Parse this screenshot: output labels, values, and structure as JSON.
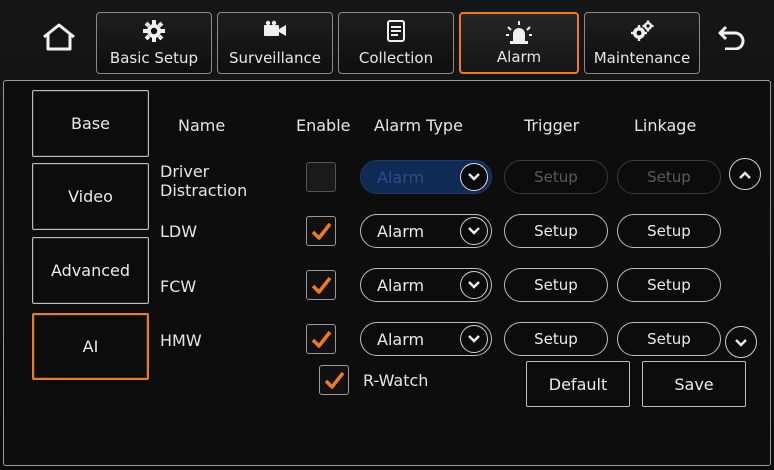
{
  "top_nav": {
    "home_icon": "home-icon",
    "back_icon": "back-arrow-icon",
    "tabs": [
      {
        "label": "Basic Setup",
        "icon": "gear-icon"
      },
      {
        "label": "Surveillance",
        "icon": "camera-icon"
      },
      {
        "label": "Collection",
        "icon": "document-icon"
      },
      {
        "label": "Alarm",
        "icon": "alarm-light-icon"
      },
      {
        "label": "Maintenance",
        "icon": "gears-icon"
      }
    ],
    "active_tab": "Alarm"
  },
  "side_menu": {
    "items": [
      {
        "label": "Base"
      },
      {
        "label": "Video"
      },
      {
        "label": "Advanced"
      },
      {
        "label": "AI"
      }
    ],
    "active_item": "AI"
  },
  "table": {
    "headers": {
      "name": "Name",
      "enable": "Enable",
      "alarm_type": "Alarm Type",
      "trigger": "Trigger",
      "linkage": "Linkage"
    },
    "rows": [
      {
        "name": "Driver\nDistraction",
        "enabled": false,
        "disabled": true,
        "alarm_type": "Alarm",
        "trigger": "Setup",
        "linkage": "Setup"
      },
      {
        "name": "LDW",
        "enabled": true,
        "disabled": false,
        "alarm_type": "Alarm",
        "trigger": "Setup",
        "linkage": "Setup"
      },
      {
        "name": "FCW",
        "enabled": true,
        "disabled": false,
        "alarm_type": "Alarm",
        "trigger": "Setup",
        "linkage": "Setup"
      },
      {
        "name": "HMW",
        "enabled": true,
        "disabled": false,
        "alarm_type": "Alarm",
        "trigger": "Setup",
        "linkage": "Setup"
      }
    ]
  },
  "r_watch": {
    "label": "R-Watch",
    "checked": true
  },
  "buttons": {
    "default_label": "Default",
    "save_label": "Save"
  },
  "colors": {
    "accent": "#f07a1e",
    "check": "#f07a1e",
    "disabled_select": "#0f2a55"
  }
}
